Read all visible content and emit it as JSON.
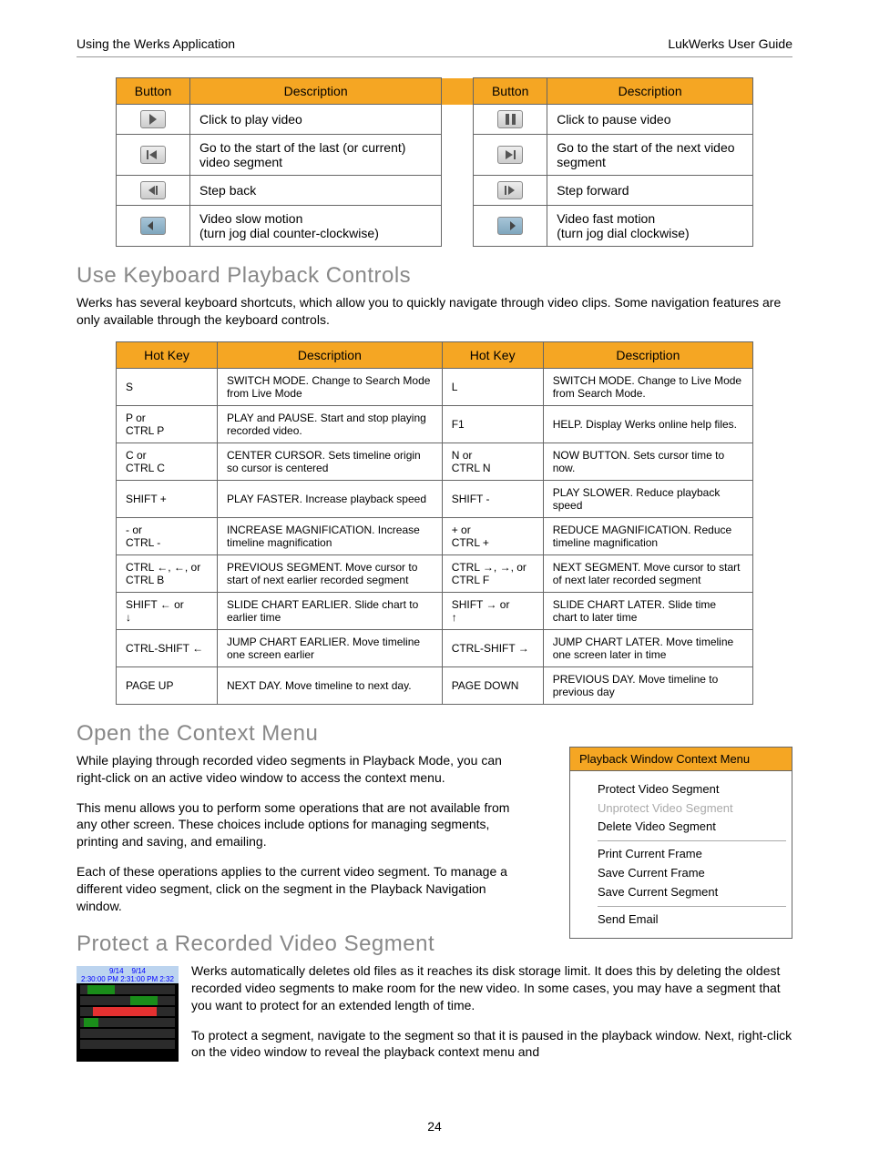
{
  "header": {
    "left": "Using the Werks Application",
    "right": "LukWerks User Guide"
  },
  "buttons_table": {
    "headers": [
      "Button",
      "Description",
      "Button",
      "Description"
    ],
    "rows": [
      {
        "l": "Click to play video",
        "r": "Click to pause video",
        "licon": "play",
        "ricon": "pause"
      },
      {
        "l": "Go to the start of the last (or current) video segment",
        "r": "Go to the start of the next video segment",
        "licon": "prev",
        "ricon": "next"
      },
      {
        "l": "Step back",
        "r": "Step forward",
        "licon": "stepback",
        "ricon": "stepfwd"
      },
      {
        "l": "Video slow motion\n(turn jog dial counter-clockwise)",
        "r": "Video fast motion\n(turn jog dial clockwise)",
        "licon": "jogleft",
        "ricon": "jogright"
      }
    ]
  },
  "section1": {
    "heading": "Use Keyboard Playback Controls",
    "para": "Werks has several keyboard shortcuts, which allow you to quickly navigate through video clips. Some navigation features are only available through the keyboard controls."
  },
  "hotkeys": {
    "headers": [
      "Hot Key",
      "Description",
      "Hot Key",
      "Description"
    ],
    "rows": [
      {
        "hk1": "S",
        "d1": "SWITCH MODE. Change to Search Mode from Live Mode",
        "hk2": "L",
        "d2": "SWITCH MODE. Change to Live Mode from Search Mode."
      },
      {
        "hk1": "P or\nCTRL P",
        "d1": "PLAY and PAUSE. Start and stop playing recorded video.",
        "hk2": "F1",
        "d2": "HELP. Display Werks online help files."
      },
      {
        "hk1": "C or\nCTRL C",
        "d1": "CENTER CURSOR. Sets timeline origin so cursor is centered",
        "hk2": "N or\nCTRL N",
        "d2": "NOW BUTTON. Sets cursor time to now."
      },
      {
        "hk1": "SHIFT +",
        "d1": "PLAY FASTER. Increase playback speed",
        "hk2": "SHIFT -",
        "d2": "PLAY SLOWER. Reduce playback speed"
      },
      {
        "hk1": "- or\nCTRL -",
        "d1": "INCREASE MAGNIFICATION. Increase timeline magnification",
        "hk2": "+ or\nCTRL +",
        "d2": "REDUCE MAGNIFICATION. Reduce timeline magnification"
      },
      {
        "hk1": "CTRL ←, ←, or\nCTRL B",
        "d1": "PREVIOUS SEGMENT. Move cursor to start of next earlier recorded segment",
        "hk2": "CTRL →, →, or\nCTRL F",
        "d2": "NEXT SEGMENT. Move cursor to start of next later recorded segment"
      },
      {
        "hk1": "SHIFT ← or\n↓",
        "d1": "SLIDE CHART EARLIER. Slide chart to earlier time",
        "hk2": "SHIFT → or\n↑",
        "d2": "SLIDE CHART LATER. Slide time chart to later time"
      },
      {
        "hk1": "CTRL-SHIFT ←",
        "d1": "JUMP CHART EARLIER. Move timeline one screen earlier",
        "hk2": "CTRL-SHIFT →",
        "d2": "JUMP CHART LATER. Move timeline one screen later in time"
      },
      {
        "hk1": "PAGE UP",
        "d1": "NEXT DAY. Move timeline to next day.",
        "hk2": "PAGE DOWN",
        "d2": "PREVIOUS DAY. Move timeline to previous day"
      }
    ]
  },
  "section2": {
    "heading": "Open the Context Menu",
    "p1": "While playing through recorded video segments in Playback Mode, you can right-click on an active video window to access the context menu.",
    "p2": "This menu allows you to perform some operations that are not available from any other screen. These choices include options for managing segments, printing and saving, and emailing.",
    "p3": "Each of these operations applies to the current video segment. To manage a different video segment, click on the segment in the Playback Navigation window."
  },
  "context_menu": {
    "title": "Playback Window Context Menu",
    "items1": [
      "Protect Video Segment",
      "Unprotect Video Segment",
      "Delete Video Segment"
    ],
    "items2": [
      "Print Current Frame",
      "Save Current Frame",
      "Save Current Segment"
    ],
    "items3": [
      "Send Email"
    ],
    "disabled_index": 1
  },
  "section3": {
    "heading": "Protect a Recorded Video Segment",
    "p1": "Werks automatically deletes old files as it reaches its disk storage limit. It does this by deleting the oldest recorded video segments to make room for the new video. In some cases, you may have a segment that you want to protect for an extended length of time.",
    "p2": "To protect a segment, navigate to the segment so that it is paused in the playback window. Next, right-click on the video window to reveal the playback context menu and"
  },
  "timeline": {
    "dates": [
      "9/14",
      "9/14"
    ],
    "times": [
      "2:30:00 PM",
      "2:31:00 PM",
      "2:32"
    ]
  },
  "page_number": "24"
}
